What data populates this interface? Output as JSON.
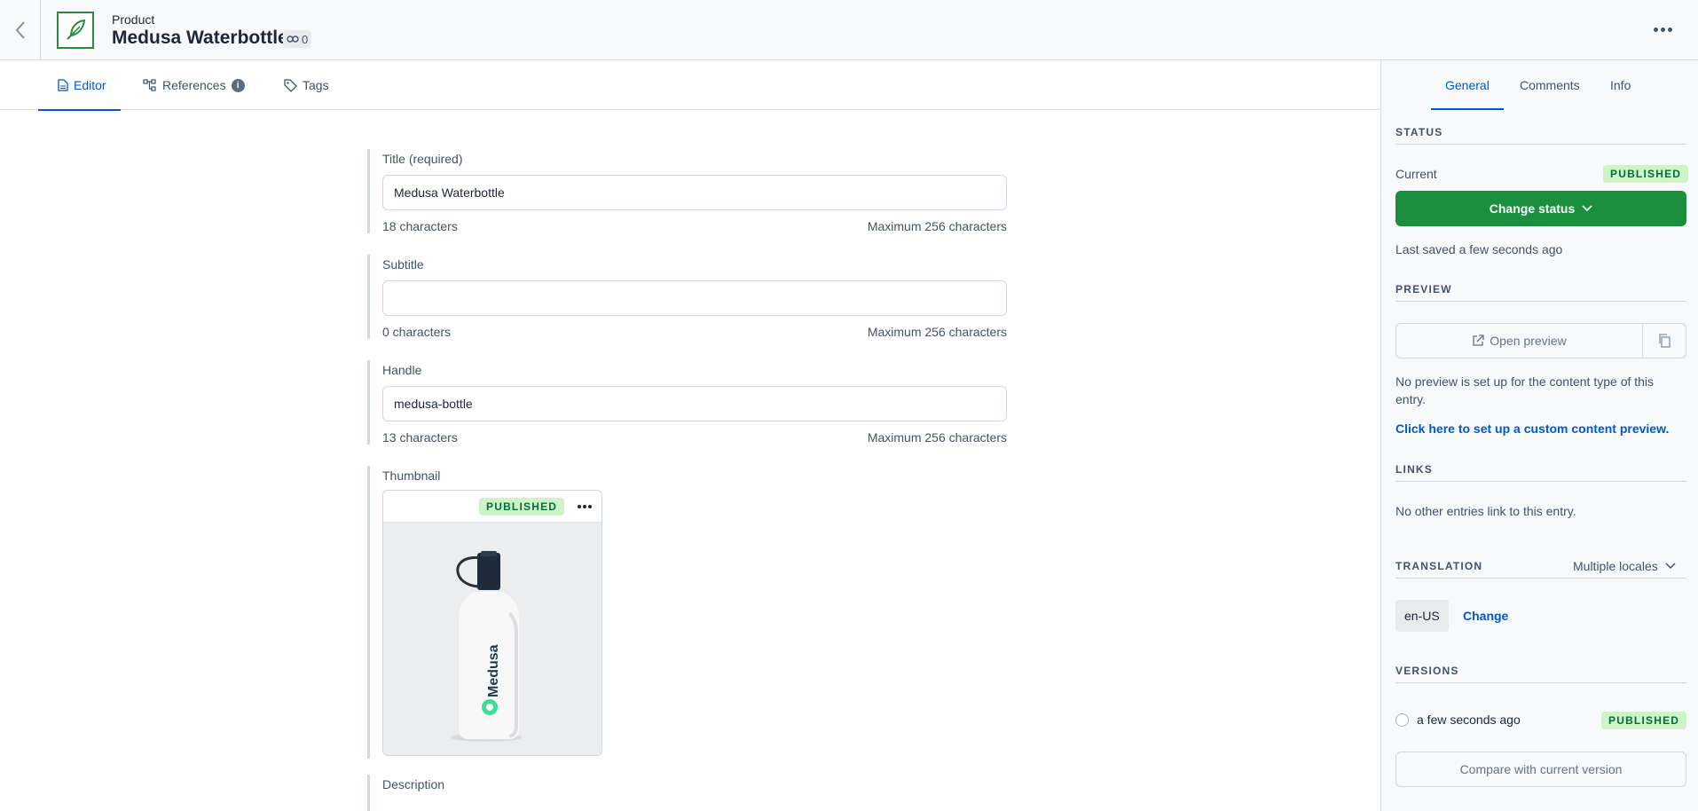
{
  "header": {
    "content_type": "Product",
    "title": "Medusa Waterbottle",
    "reference_count": "0",
    "icons": {
      "back": "chevron-left-icon",
      "entry": "feather-icon",
      "link": "link-icon",
      "more": "ellipsis-icon"
    }
  },
  "tabs": [
    {
      "label": "Editor",
      "icon": "document-icon",
      "active": true
    },
    {
      "label": "References",
      "icon": "hierarchy-icon",
      "info": "i"
    },
    {
      "label": "Tags",
      "icon": "tag-icon"
    }
  ],
  "fields": {
    "title": {
      "label": "Title (required)",
      "value": "Medusa Waterbottle",
      "count": "18 characters",
      "max": "Maximum 256 characters"
    },
    "subtitle": {
      "label": "Subtitle",
      "value": "",
      "count": "0 characters",
      "max": "Maximum 256 characters"
    },
    "handle": {
      "label": "Handle",
      "value": "medusa-bottle",
      "count": "13 characters",
      "max": "Maximum 256 characters"
    },
    "thumbnail": {
      "label": "Thumbnail",
      "status": "PUBLISHED",
      "image_brand": "Medusa"
    },
    "description": {
      "label": "Description"
    }
  },
  "sidebar": {
    "tabs": [
      "General",
      "Comments",
      "Info"
    ],
    "status": {
      "title": "STATUS",
      "current_label": "Current",
      "current_badge": "PUBLISHED",
      "change_button": "Change status",
      "last_saved": "Last saved a few seconds ago"
    },
    "preview": {
      "title": "PREVIEW",
      "open_button": "Open preview",
      "note": "No preview is set up for the content type of this entry.",
      "setup_link": "Click here to set up a custom content preview."
    },
    "links": {
      "title": "LINKS",
      "note": "No other entries link to this entry."
    },
    "translation": {
      "title": "TRANSLATION",
      "locales_dropdown": "Multiple locales",
      "locale": "en-US",
      "change_link": "Change"
    },
    "versions": {
      "title": "VERSIONS",
      "entry_time": "a few seconds ago",
      "entry_badge": "PUBLISHED",
      "compare_button": "Compare with current version"
    }
  },
  "colors": {
    "accent": "#0059c8",
    "primary_green": "#1a8f3d",
    "published_bg": "#cdf3c6",
    "published_text": "#006f3c"
  }
}
